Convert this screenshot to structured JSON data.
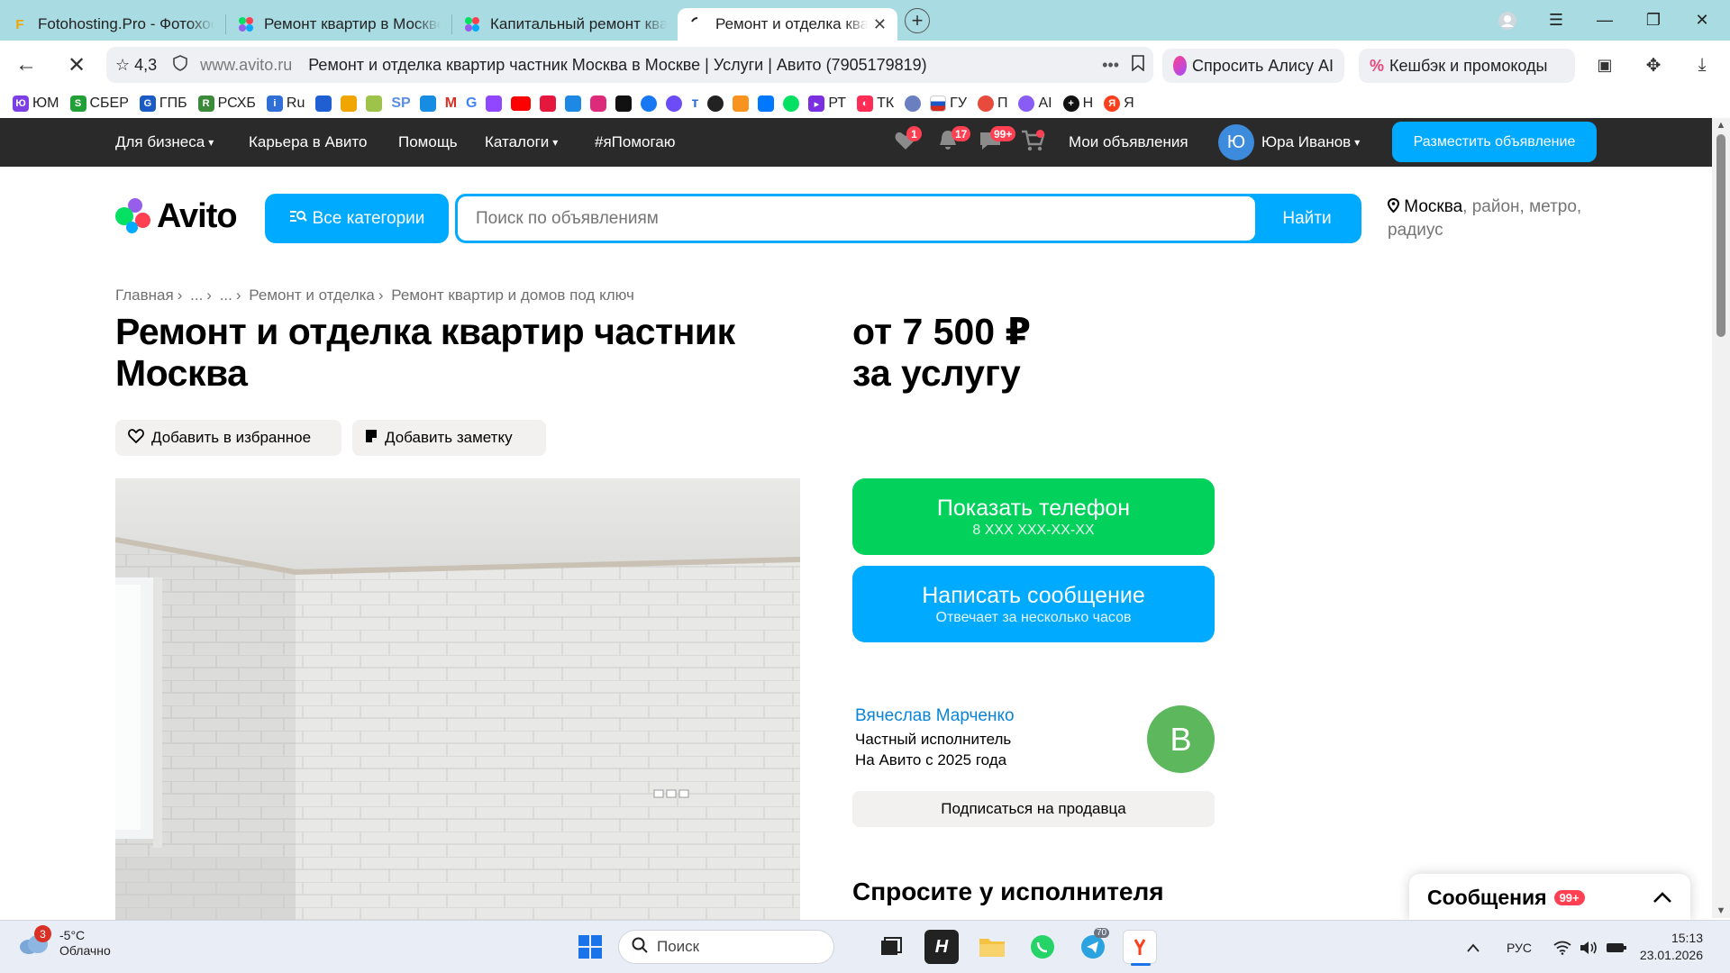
{
  "browser": {
    "tabs": [
      {
        "label": "Fotohosting.Pro - Фотохостинг",
        "active": false
      },
      {
        "label": "Ремонт квартир в Москве",
        "active": false
      },
      {
        "label": "Капитальный ремонт квартир",
        "active": false
      },
      {
        "label": "Ремонт и отделка квартир",
        "active": true
      }
    ],
    "rating": "4,3",
    "host": "www.avito.ru",
    "page_title": "Ремонт и отделка квартир частник Москва в Москве | Услуги | Авито (7905179819)",
    "alice_label": "Спросить Алису AI",
    "cashback_label": "Кешбэк и промокоды",
    "bookmarks": [
      "ЮМ",
      "СБЕР",
      "ГПБ",
      "РСХБ",
      "Ru",
      "РТ",
      "ТК",
      "ГУ",
      "П",
      "AI",
      "Н",
      "Я"
    ]
  },
  "topnav": {
    "business": "Для бизнеса",
    "career": "Карьера в Авито",
    "help": "Помощь",
    "catalogs": "Каталоги",
    "help_tag": "#яПомогаю",
    "fav_badge": "1",
    "notif_badge": "17",
    "msg_badge": "99+",
    "my_ads": "Мои объявления",
    "user_initial": "Ю",
    "user_name": "Юра Иванов",
    "post_ad": "Разместить объявление"
  },
  "search": {
    "logo": "Avito",
    "categories": "Все категории",
    "placeholder": "Поиск по объявлениям",
    "find": "Найти",
    "city": "Москва",
    "location_rest": ", район, метро, радиус"
  },
  "breadcrumbs": [
    "Главная",
    "...",
    "...",
    "Ремонт и отделка",
    "Ремонт квартир и домов под ключ"
  ],
  "listing": {
    "title": "Ремонт и отделка квартир частник Москва",
    "price_line1": "от 7 500 ₽",
    "price_line2": "за услугу",
    "add_favorite": "Добавить в избранное",
    "add_note": "Добавить заметку"
  },
  "contact": {
    "show_phone": "Показать телефон",
    "phone_masked": "8 XXX XXX-XX-XX",
    "write_message": "Написать сообщение",
    "response_time": "Отвечает за несколько часов"
  },
  "seller": {
    "name": "Вячеслав Марченко",
    "type": "Частный исполнитель",
    "since": "На Авито с 2025 года",
    "initial": "В",
    "subscribe": "Подписаться на продавца"
  },
  "ask_heading": "Спросите у исполнителя",
  "messages_panel": {
    "label": "Сообщения",
    "badge": "99+"
  },
  "taskbar": {
    "weather_badge": "3",
    "temperature": "-5°C",
    "condition": "Облачно",
    "search_placeholder": "Поиск",
    "telegram_badge": "70",
    "lang": "РУС",
    "time": "15:13",
    "date": "23.01.2026"
  },
  "colors": {
    "accent": "#00aaff",
    "green": "#02d15c",
    "navbar": "#2a2a2a",
    "badge": "#ff4053"
  }
}
